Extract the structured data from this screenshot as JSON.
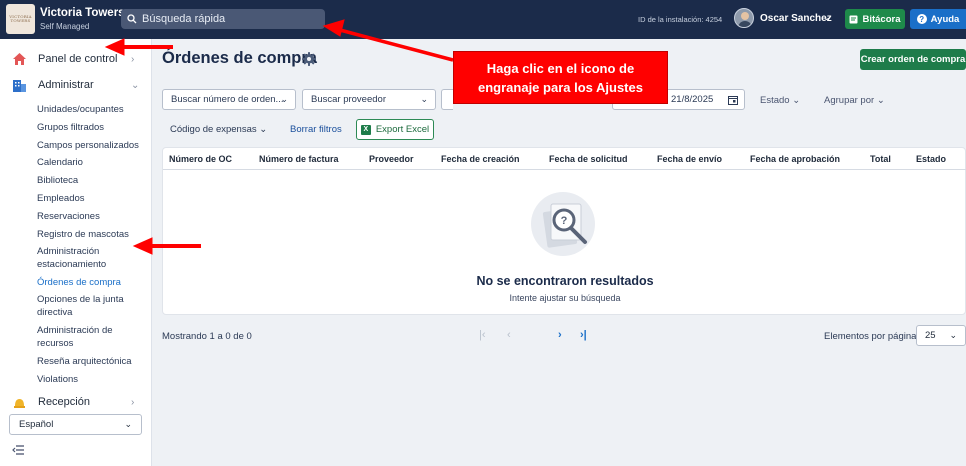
{
  "header": {
    "brand_title": "Victoria Towers",
    "brand_subtitle": "Self Managed",
    "logo_text": "VICTORIA TOWERS",
    "search_placeholder": "Búsqueda rápida",
    "installation_id": "ID de la instalación: 4254",
    "user_name": "Oscar Sanchez",
    "logbook_label": "Bitácora",
    "help_label": "Ayuda"
  },
  "sidebar": {
    "main_items": [
      {
        "label": "Panel de control",
        "icon": "house-icon"
      },
      {
        "label": "Administrar",
        "icon": "building-icon"
      },
      {
        "label": "Recepción",
        "icon": "bell-icon"
      }
    ],
    "admin_items": [
      "Unidades/ocupantes",
      "Grupos filtrados",
      "Campos personalizados",
      "Calendario",
      "Biblioteca",
      "Empleados",
      "Reservaciones",
      "Registro de mascotas",
      "Administración estacionamiento",
      "Órdenes de compra",
      "Opciones de la junta directiva",
      "Administración de recursos",
      "Reseña arquitectónica",
      "Violations"
    ],
    "language": "Español"
  },
  "page": {
    "title": "Órdenes de compra",
    "create_button": "Crear orden de compra"
  },
  "filters": {
    "order_number_placeholder": "Buscar número de orden...",
    "supplier_placeholder": "Buscar proveedor",
    "date_value": "21/8/2025",
    "status_label": "Estado",
    "group_by_label": "Agrupar por",
    "expense_code_label": "Código de expensas",
    "clear_filters": "Borrar filtros",
    "export_excel": "Export Excel"
  },
  "table": {
    "columns": [
      "Número de OC",
      "Número de factura",
      "Proveedor",
      "Fecha de creación",
      "Fecha de solicitud",
      "Fecha de envío",
      "Fecha de aprobación",
      "Total",
      "Estado"
    ],
    "empty_title": "No se encontraron resultados",
    "empty_subtitle": "Intente ajustar su búsqueda"
  },
  "pagination": {
    "showing": "Mostrando 1 a 0 de 0",
    "per_page_label": "Elementos por página",
    "per_page_value": "25"
  },
  "annotation": {
    "line1": "Haga clic en el icono de",
    "line2": "engranaje para los Ajustes"
  },
  "colors": {
    "header_bg": "#1b2b4a",
    "primary_green": "#1e7c4a",
    "help_blue": "#1a6fc8",
    "annotation_red": "#ff0000"
  }
}
